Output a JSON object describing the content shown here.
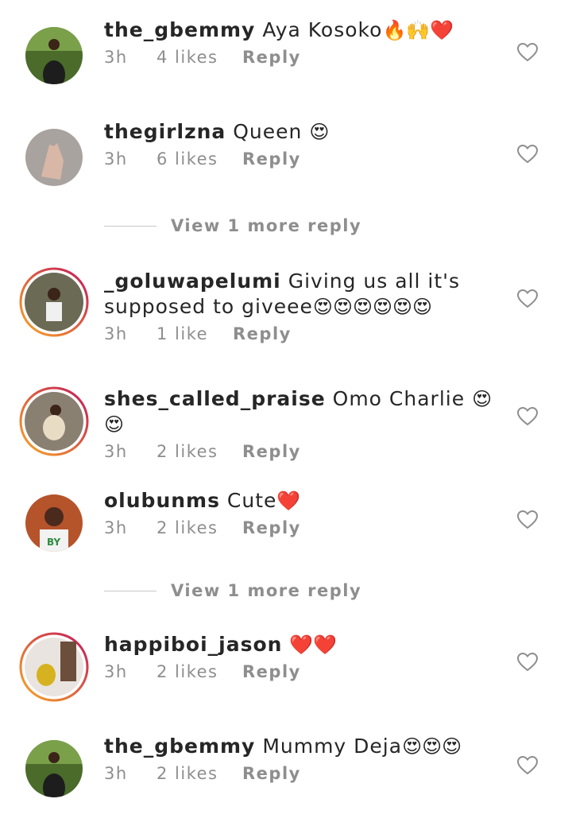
{
  "comments": [
    {
      "username": "the_gbemmy",
      "text": "Aya Kosoko",
      "emoji": "🔥🙌❤️",
      "time": "3h",
      "likes": "4 likes",
      "reply": "Reply"
    },
    {
      "username": "thegirlzna",
      "text": "Queen",
      "emoji": "😍",
      "time": "3h",
      "likes": "6 likes",
      "reply": "Reply"
    },
    {
      "username": "_goluwapelumi",
      "text": "Giving us all it's supposed to giveee",
      "emoji": "😍😍😍😍😍😍",
      "time": "3h",
      "likes": "1 like",
      "reply": "Reply"
    },
    {
      "username": "shes_called_praise",
      "text": "Omo Charlie",
      "emoji": "😍😍",
      "time": "3h",
      "likes": "2 likes",
      "reply": "Reply"
    },
    {
      "username": "olubunms",
      "text": "Cute",
      "emoji": "❤️",
      "time": "3h",
      "likes": "2 likes",
      "reply": "Reply"
    },
    {
      "username": "happiboi_jason",
      "text": "",
      "emoji": "❤️❤️",
      "time": "3h",
      "likes": "2 likes",
      "reply": "Reply"
    },
    {
      "username": "the_gbemmy",
      "text": "Mummy Deja",
      "emoji": "😍😍😍",
      "time": "3h",
      "likes": "2 likes",
      "reply": "Reply"
    }
  ],
  "view_more": [
    "View 1 more reply",
    "View 1 more reply"
  ],
  "icons": {
    "like": "heart-outline-icon"
  },
  "colors": {
    "text": "#262626",
    "meta": "#8e8e8e",
    "story_ring_start": "#f9a825",
    "story_ring_end": "#c2185b"
  }
}
